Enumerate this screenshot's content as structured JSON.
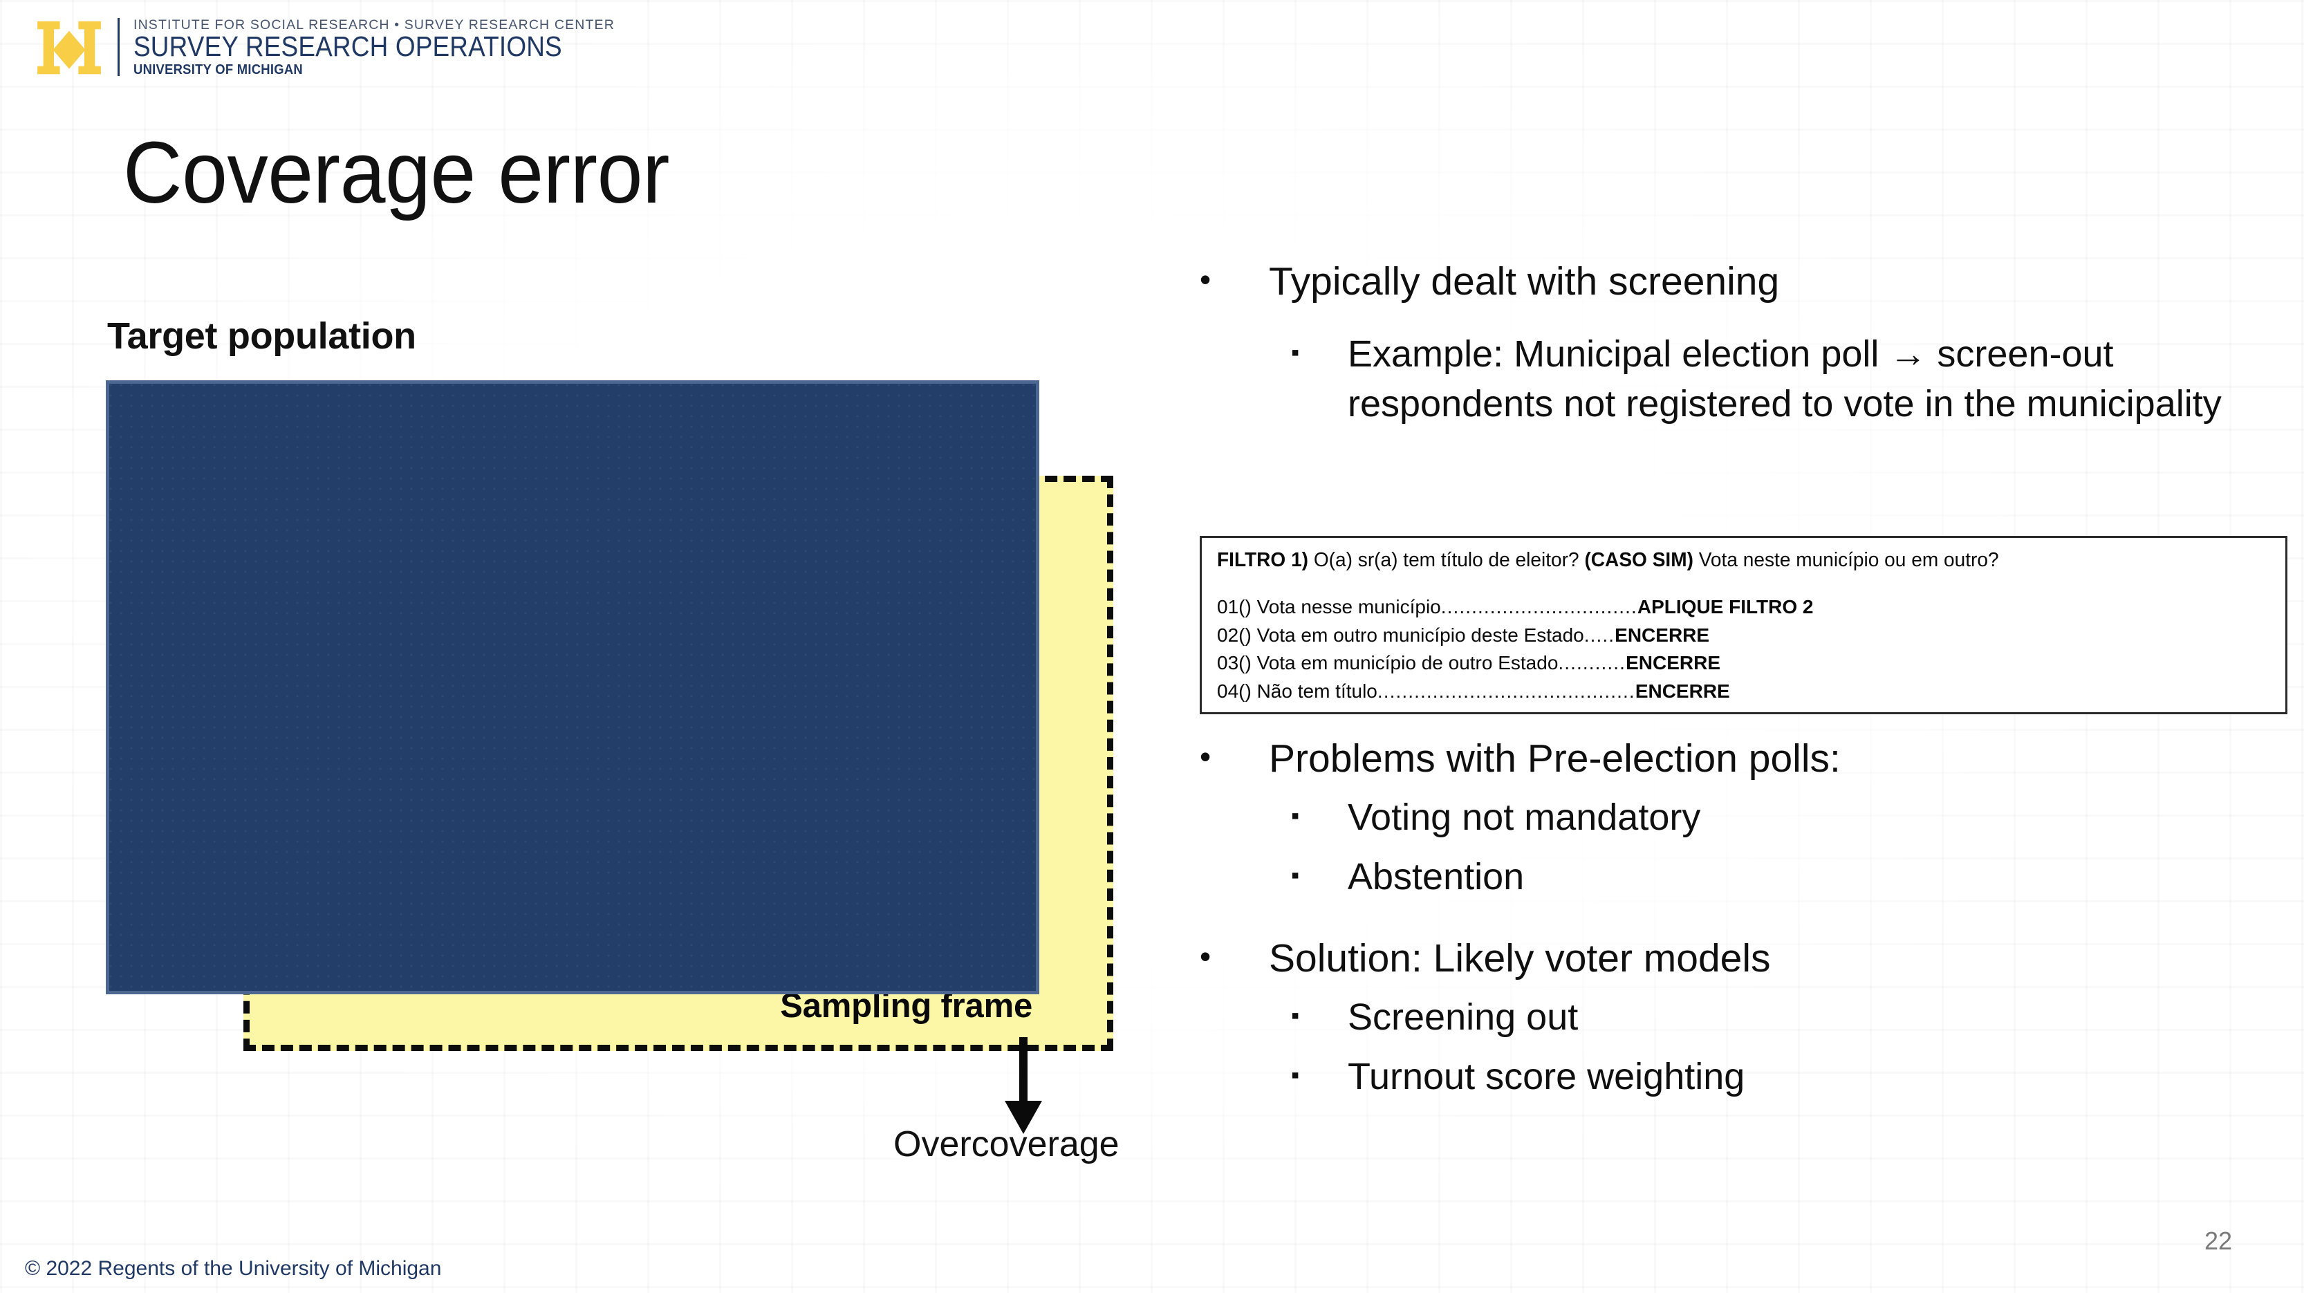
{
  "brand": {
    "logo_icon": "michigan-block-m-icon",
    "maize": "#F7CE46",
    "navy": "#1F3864",
    "line1": "INSTITUTE FOR SOCIAL RESEARCH • SURVEY RESEARCH CENTER",
    "line2": "SURVEY RESEARCH OPERATIONS",
    "line3": "UNIVERSITY OF MICHIGAN"
  },
  "slide": {
    "title": "Coverage error",
    "page_number": "22",
    "footer": "© 2022 Regents of the University of Michigan"
  },
  "diagram": {
    "target_label": "Target population",
    "frame_label": "Sampling frame",
    "overcoverage_label": "Overcoverage",
    "arrow_icon": "down-arrow-icon",
    "target_color": "#233F69",
    "frame_color": "#FBF7A6",
    "frame_border_color": "#0D0D0D",
    "target_border_color": "#4C6792"
  },
  "bullets": [
    {
      "level": 1,
      "marker": "•",
      "text": "Typically dealt with screening"
    },
    {
      "level": 2,
      "marker": "▪",
      "text": "Example: Municipal election poll → screen-out respondents not registered to vote in the municipality"
    },
    {
      "level": 1,
      "marker": "•",
      "text": "Problems with Pre-election polls:"
    },
    {
      "level": 2,
      "marker": "▪",
      "text": "Voting not mandatory"
    },
    {
      "level": 2,
      "marker": "▪",
      "text": "Abstention"
    },
    {
      "level": 1,
      "marker": "•",
      "text": "Solution: Likely voter models"
    },
    {
      "level": 2,
      "marker": "▪",
      "text": "Screening out"
    },
    {
      "level": 2,
      "marker": "▪",
      "text": "Turnout score weighting"
    }
  ],
  "questionnaire": {
    "head_bold_1": "FILTRO 1)",
    "head_plain_1": " O(a) sr(a) tem título de eleitor? ",
    "head_bold_2": " (CASO SIM)",
    "head_plain_2": " Vota neste município ou em outro?",
    "options": [
      {
        "code": "01(",
        "text": "  ) Vota nesse município",
        "dots": "................................",
        "action": "APLIQUE FILTRO 2",
        "pad": ""
      },
      {
        "code": "02(",
        "text": "  ) Vota em outro município deste Estado",
        "dots": ".....",
        "action": "ENCERRE",
        "pad": " "
      },
      {
        "code": "03(",
        "text": "  ) Vota em município de outro Estado",
        "dots": "...........",
        "action": "ENCERRE",
        "pad": ""
      },
      {
        "code": "04(",
        "text": "  ) Não tem título",
        "dots": "..........................................",
        "action": "ENCERRE",
        "pad": ""
      }
    ]
  }
}
